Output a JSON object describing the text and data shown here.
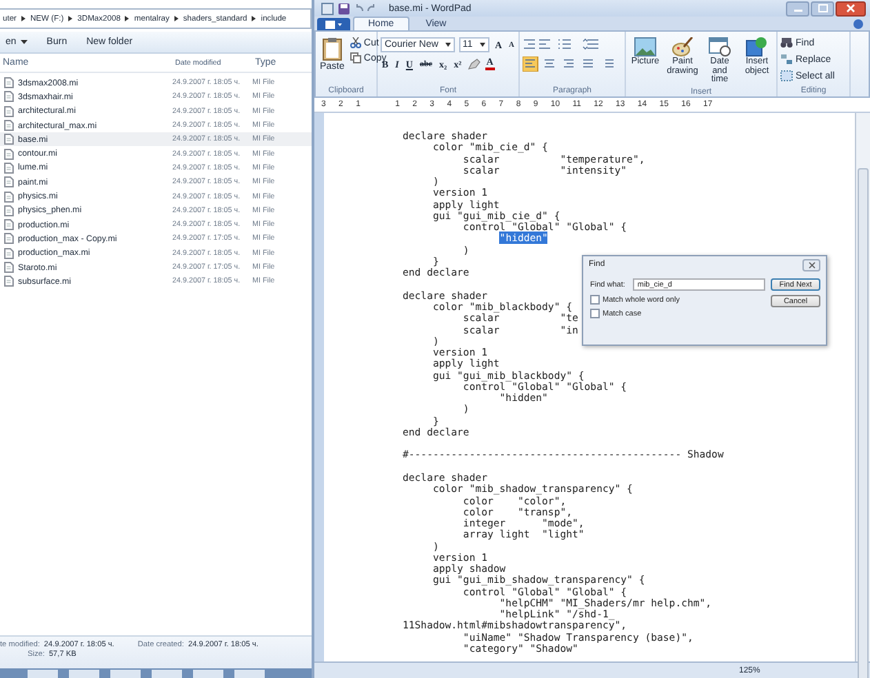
{
  "explorer": {
    "breadcrumb": [
      "uter",
      "NEW (F:)",
      "3DMax2008",
      "mentalray",
      "shaders_standard",
      "include"
    ],
    "toolbar": [
      {
        "label": "en",
        "dropdown": true
      },
      {
        "label": "Burn",
        "dropdown": false
      },
      {
        "label": "New folder",
        "dropdown": false
      }
    ],
    "columns": [
      "Name",
      "Date modified",
      "Type"
    ],
    "files": [
      {
        "name": "3dsmax2008.mi",
        "date": "24.9.2007 г. 18:05 ч.",
        "type": "MI File",
        "selected": false
      },
      {
        "name": "3dsmaxhair.mi",
        "date": "24.9.2007 г. 18:05 ч.",
        "type": "MI File",
        "selected": false
      },
      {
        "name": "architectural.mi",
        "date": "24.9.2007 г. 18:05 ч.",
        "type": "MI File",
        "selected": false
      },
      {
        "name": "architectural_max.mi",
        "date": "24.9.2007 г. 18:05 ч.",
        "type": "MI File",
        "selected": false
      },
      {
        "name": "base.mi",
        "date": "24.9.2007 г. 18:05 ч.",
        "type": "MI File",
        "selected": true
      },
      {
        "name": "contour.mi",
        "date": "24.9.2007 г. 18:05 ч.",
        "type": "MI File",
        "selected": false
      },
      {
        "name": "lume.mi",
        "date": "24.9.2007 г. 18:05 ч.",
        "type": "MI File",
        "selected": false
      },
      {
        "name": "paint.mi",
        "date": "24.9.2007 г. 18:05 ч.",
        "type": "MI File",
        "selected": false
      },
      {
        "name": "physics.mi",
        "date": "24.9.2007 г. 18:05 ч.",
        "type": "MI File",
        "selected": false
      },
      {
        "name": "physics_phen.mi",
        "date": "24.9.2007 г. 18:05 ч.",
        "type": "MI File",
        "selected": false
      },
      {
        "name": "production.mi",
        "date": "24.9.2007 г. 18:05 ч.",
        "type": "MI File",
        "selected": false
      },
      {
        "name": "production_max - Copy.mi",
        "date": "24.9.2007 г. 17:05 ч.",
        "type": "MI File",
        "selected": false
      },
      {
        "name": "production_max.mi",
        "date": "24.9.2007 г. 18:05 ч.",
        "type": "MI File",
        "selected": false
      },
      {
        "name": "Staroto.mi",
        "date": "24.9.2007 г. 17:05 ч.",
        "type": "MI File",
        "selected": false
      },
      {
        "name": "subsurface.mi",
        "date": "24.9.2007 г. 18:05 ч.",
        "type": "MI File",
        "selected": false
      }
    ],
    "details": [
      {
        "label": "te modified:",
        "value": "24.9.2007 г. 18:05 ч."
      },
      {
        "label": "Date created:",
        "value": "24.9.2007 г. 18:05 ч."
      },
      {
        "label": "Size:",
        "value": "57,7 KB"
      }
    ]
  },
  "wordpad": {
    "title": "base.mi - WordPad",
    "tabs": [
      {
        "label": "Home",
        "selected": true
      },
      {
        "label": "View",
        "selected": false
      }
    ],
    "clipboard": {
      "label": "Clipboard",
      "paste": "Paste",
      "cut": "Cut",
      "copy": "Copy"
    },
    "font": {
      "label": "Font",
      "family": "Courier New",
      "size": "11",
      "grow": "A",
      "shrink": "A",
      "format": [
        "B",
        "I",
        "U",
        "abc",
        "x₂",
        "x²"
      ],
      "color_button": "A"
    },
    "paragraph": {
      "label": "Paragraph"
    },
    "insert": {
      "label": "Insert",
      "items": [
        "Picture",
        "Paint drawing",
        "Date and time",
        "Insert object"
      ]
    },
    "editing": {
      "label": "Editing",
      "items": [
        "Find",
        "Replace",
        "Select all"
      ]
    },
    "ruler": [
      "3",
      "2",
      "1",
      "1",
      "2",
      "3",
      "4",
      "5",
      "6",
      "7",
      "8",
      "9",
      "10",
      "11",
      "12",
      "13",
      "14",
      "15",
      "16",
      "17"
    ],
    "lines": [
      {
        "text": "declare shader",
        "selected": false
      },
      {
        "text": "     color \"mib_cie_d\" {",
        "selected": false
      },
      {
        "text": "          scalar          \"temperature\",",
        "selected": false
      },
      {
        "text": "          scalar          \"intensity\"",
        "selected": false
      },
      {
        "text": "     )",
        "selected": false
      },
      {
        "text": "     version 1",
        "selected": false
      },
      {
        "text": "     apply light",
        "selected": false
      },
      {
        "text": "     gui \"gui_mib_cie_d\" {",
        "selected": false
      },
      {
        "text": "          control \"Global\" \"Global\" {",
        "selected": false
      },
      {
        "kind": "selected",
        "text": "                \"hidden\""
      },
      {
        "text": "          )",
        "selected": false
      },
      {
        "text": "     }",
        "selected": false
      },
      {
        "text": "end declare",
        "selected": false
      },
      {
        "kind": "blank"
      },
      {
        "text": "declare shader",
        "selected": false
      },
      {
        "text": "     color \"mib_blackbody\" {",
        "selected": false
      },
      {
        "text": "          scalar          \"te",
        "selected": false
      },
      {
        "text": "          scalar          \"in",
        "selected": false
      },
      {
        "text": "     )",
        "selected": false
      },
      {
        "text": "     version 1",
        "selected": false
      },
      {
        "text": "     apply light",
        "selected": false
      },
      {
        "text": "     gui \"gui_mib_blackbody\" {",
        "selected": false
      },
      {
        "text": "          control \"Global\" \"Global\" {",
        "selected": false
      },
      {
        "text": "                \"hidden\"",
        "selected": false
      },
      {
        "text": "          )",
        "selected": false
      },
      {
        "text": "     }",
        "selected": false
      },
      {
        "text": "end declare",
        "selected": false
      },
      {
        "kind": "blank"
      },
      {
        "text": "#--------------------------------------------- Shadow",
        "selected": false
      },
      {
        "kind": "blank"
      },
      {
        "text": "declare shader",
        "selected": false
      },
      {
        "text": "     color \"mib_shadow_transparency\" {",
        "selected": false
      },
      {
        "text": "          color    \"color\",",
        "selected": false
      },
      {
        "text": "          color    \"transp\",",
        "selected": false
      },
      {
        "text": "          integer      \"mode\",",
        "selected": false
      },
      {
        "text": "          array light  \"light\"",
        "selected": false
      },
      {
        "text": "     )",
        "selected": false
      },
      {
        "text": "     version 1",
        "selected": false
      },
      {
        "text": "     apply shadow",
        "selected": false
      },
      {
        "text": "     gui \"gui_mib_shadow_transparency\" {",
        "selected": false
      },
      {
        "text": "          control \"Global\" \"Global\" {",
        "selected": false
      },
      {
        "text": "                \"helpCHM\" \"MI_Shaders/mr help.chm\",",
        "selected": false
      },
      {
        "text": "                \"helpLink\" \"/shd-1_",
        "selected": false
      },
      {
        "text": "11Shadow.html#mibshadowtransparency\",",
        "selected": false
      },
      {
        "text": "          \"uiName\" \"Shadow Transparency (base)\",",
        "selected": false
      },
      {
        "text": "          \"category\" \"Shadow\"",
        "selected": false
      }
    ],
    "find_dialog": {
      "title": "Find",
      "find_label": "Find what:",
      "value": "mib_cie_d",
      "buttons": [
        "Find Next",
        "Cancel"
      ],
      "options": [
        {
          "label": "Match whole word only",
          "checked": false
        },
        {
          "label": "Match case",
          "checked": false
        }
      ]
    },
    "zoom": "125%"
  }
}
